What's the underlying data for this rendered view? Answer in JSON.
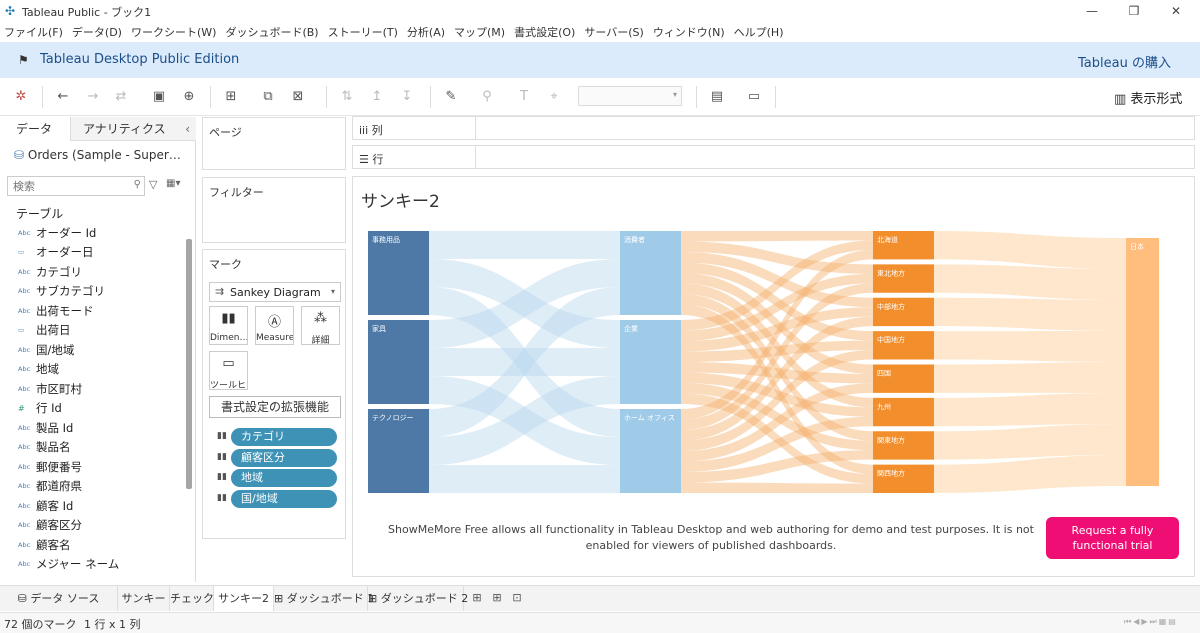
{
  "window": {
    "title": "Tableau Public - ブック1"
  },
  "menu": [
    "ファイル(F)",
    "データ(D)",
    "ワークシート(W)",
    "ダッシュボード(B)",
    "ストーリー(T)",
    "分析(A)",
    "マップ(M)",
    "書式設定(O)",
    "サーバー(S)",
    "ウィンドウ(N)",
    "ヘルプ(H)"
  ],
  "banner": {
    "edition": "Tableau Desktop Public Edition",
    "buy": "Tableau の購入"
  },
  "toolbar": {
    "show_me": "表示形式"
  },
  "data_pane": {
    "tabs": [
      "データ",
      "アナリティクス"
    ],
    "datasource": "Orders (Sample - Super…",
    "search_placeholder": "検索",
    "tables_header": "テーブル",
    "fields": [
      {
        "type": "Abc",
        "name": "オーダー Id"
      },
      {
        "type": "date",
        "name": "オーダー日"
      },
      {
        "type": "Abc",
        "name": "カテゴリ"
      },
      {
        "type": "Abc",
        "name": "サブカテゴリ"
      },
      {
        "type": "Abc",
        "name": "出荷モード"
      },
      {
        "type": "date",
        "name": "出荷日"
      },
      {
        "type": "Abc",
        "name": "国/地域"
      },
      {
        "type": "Abc",
        "name": "地域"
      },
      {
        "type": "Abc",
        "name": "市区町村"
      },
      {
        "type": "#",
        "name": "行 Id"
      },
      {
        "type": "Abc",
        "name": "製品 Id"
      },
      {
        "type": "Abc",
        "name": "製品名"
      },
      {
        "type": "Abc",
        "name": "郵便番号"
      },
      {
        "type": "Abc",
        "name": "都道府県"
      },
      {
        "type": "Abc",
        "name": "顧客 Id"
      },
      {
        "type": "Abc",
        "name": "顧客区分"
      },
      {
        "type": "Abc",
        "name": "顧客名"
      },
      {
        "type": "Abc",
        "name": "メジャー ネーム"
      }
    ]
  },
  "cards": {
    "pages": "ページ",
    "filters": "フィルター",
    "marks": "マーク",
    "mark_type": "Sankey Diagram",
    "mark_buttons": [
      "Dimen…",
      "Measure",
      "詳細",
      "ツールヒ…"
    ],
    "format_extension": "書式設定の拡張機能",
    "pills": [
      "カテゴリ",
      "顧客区分",
      "地域",
      "国/地域"
    ]
  },
  "shelves": {
    "columns": "列",
    "rows": "行"
  },
  "sheet": {
    "title": "サンキー2",
    "notice": "ShowMeMore Free allows all functionality in Tableau Desktop and web authoring for demo and test purposes. It is not enabled for viewers of published dashboards.",
    "trial_button": "Request a fully functional trial"
  },
  "colors": {
    "category": "#4e79a7",
    "segment": "#a0cbe8",
    "region": "#f28e2b",
    "country": "#ffbe7d",
    "pill": "#3d92b6",
    "trial": "#ee0e74",
    "banner": "#dcebfb"
  },
  "chart_data": {
    "type": "sankey",
    "levels": [
      {
        "field": "カテゴリ",
        "nodes": [
          "事務用品",
          "家具",
          "テクノロジー"
        ]
      },
      {
        "field": "顧客区分",
        "nodes": [
          "消費者",
          "企業",
          "ホーム オフィス"
        ]
      },
      {
        "field": "地域",
        "nodes": [
          "北海道",
          "東北地方",
          "中部地方",
          "中国地方",
          "四国",
          "九州",
          "関東地方",
          "関西地方"
        ]
      },
      {
        "field": "国/地域",
        "nodes": [
          "日本"
        ]
      }
    ]
  },
  "tabs": {
    "datasource": "データ ソース",
    "sheets": [
      "サンキー",
      "チェック",
      "サンキー2",
      "ダッシュボード 1",
      "ダッシュボード 2"
    ]
  },
  "status": {
    "marks": "72 個のマーク",
    "dims": "1 行 x 1 列"
  }
}
